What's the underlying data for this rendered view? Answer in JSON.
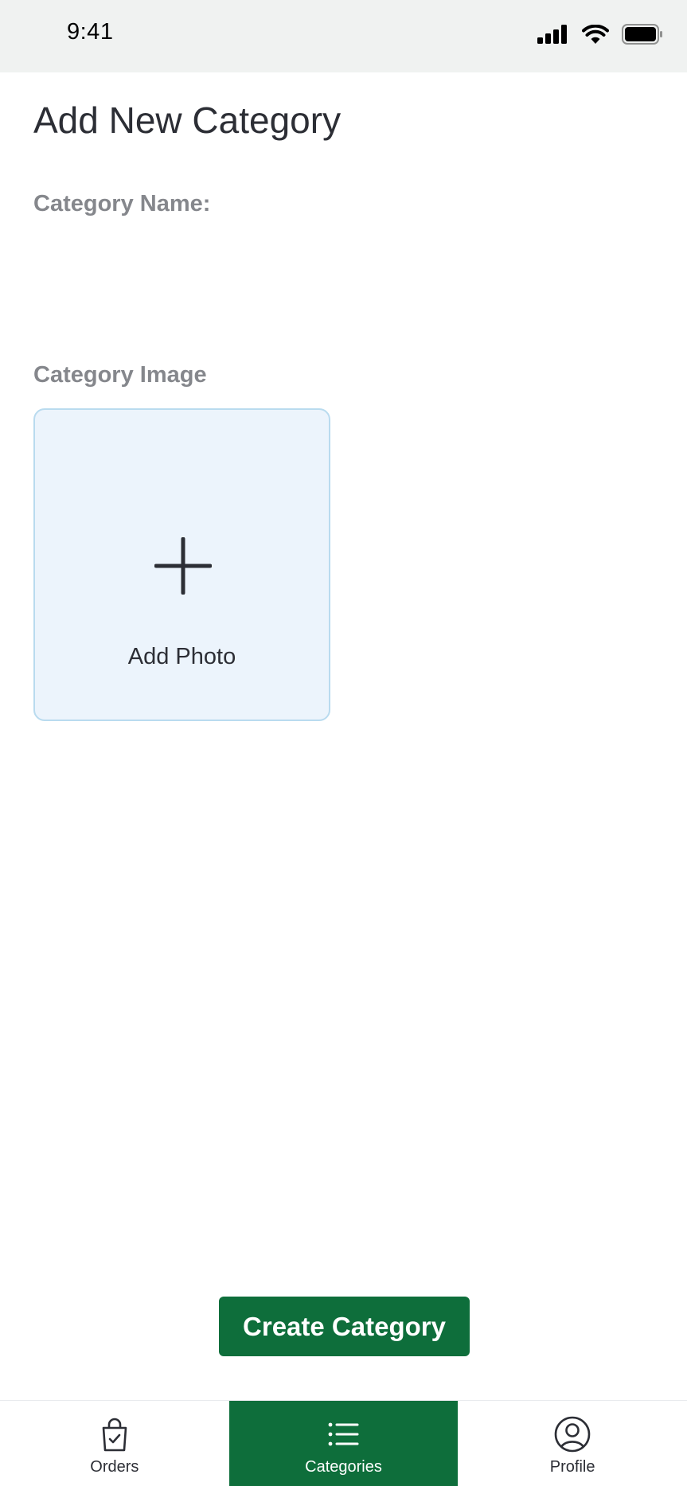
{
  "status_bar": {
    "time": "9:41",
    "icons": [
      "signal-icon",
      "wifi-icon",
      "battery-icon"
    ]
  },
  "page": {
    "title": "Add New Category"
  },
  "form": {
    "name_label": "Category Name:",
    "name_value": "",
    "image_label": "Category Image",
    "add_photo_label": "Add Photo",
    "submit_label": "Create Category"
  },
  "tabs": [
    {
      "label": "Orders",
      "icon": "shopping-bag-check-icon",
      "active": false
    },
    {
      "label": "Categories",
      "icon": "list-icon",
      "active": true
    },
    {
      "label": "Profile",
      "icon": "user-circle-icon",
      "active": false
    }
  ],
  "colors": {
    "accent": "#0e6e3b",
    "photo_box_bg": "#ecf4fc",
    "photo_box_border": "#b9dbef",
    "text_dark": "#2c2e35",
    "label_gray": "#85878c"
  }
}
